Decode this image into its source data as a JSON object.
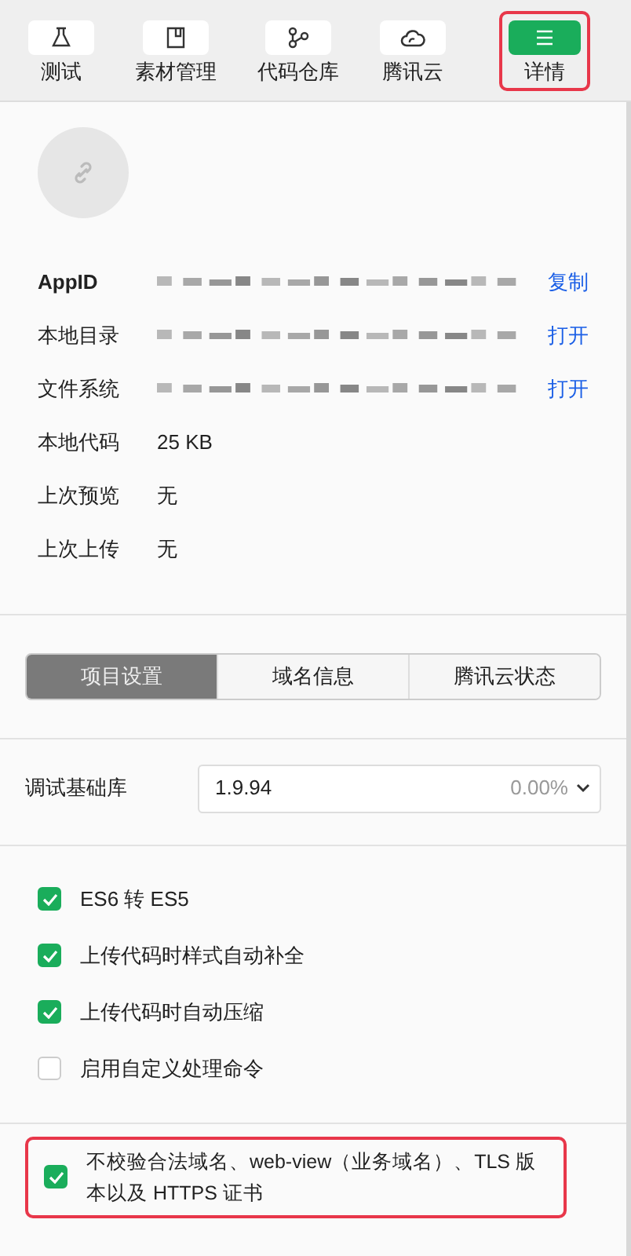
{
  "toolbar": [
    {
      "label": "测试",
      "selected": false,
      "highlighted": false
    },
    {
      "label": "素材管理",
      "selected": false,
      "highlighted": false
    },
    {
      "label": "代码仓库",
      "selected": false,
      "highlighted": false
    },
    {
      "label": "腾讯云",
      "selected": false,
      "highlighted": false
    },
    {
      "label": "详情",
      "selected": true,
      "highlighted": true
    }
  ],
  "info_rows": [
    {
      "label": "AppID",
      "kind": "blurred",
      "action": "复制",
      "bold": true
    },
    {
      "label": "本地目录",
      "kind": "blurred",
      "action": "打开",
      "bold": false
    },
    {
      "label": "文件系统",
      "kind": "blurred",
      "action": "打开",
      "bold": false
    },
    {
      "label": "本地代码",
      "kind": "text",
      "value": "25 KB",
      "bold": false
    },
    {
      "label": "上次预览",
      "kind": "text",
      "value": "无",
      "bold": false
    },
    {
      "label": "上次上传",
      "kind": "text",
      "value": "无",
      "bold": false
    }
  ],
  "tabs": [
    {
      "label": "项目设置",
      "selected": true
    },
    {
      "label": "域名信息",
      "selected": false
    },
    {
      "label": "腾讯云状态",
      "selected": false
    }
  ],
  "base_library": {
    "label": "调试基础库",
    "value": "1.9.94",
    "share": "0.00%"
  },
  "options": [
    {
      "label": "ES6 转 ES5",
      "checked": true
    },
    {
      "label": "上传代码时样式自动补全",
      "checked": true
    },
    {
      "label": "上传代码时自动压缩",
      "checked": true
    },
    {
      "label": "启用自定义处理命令",
      "checked": false
    }
  ],
  "extra_options": [
    {
      "label": "不校验合法域名、web-view（业务域名）、TLS 版本以及 HTTPS 证书",
      "checked": true,
      "highlighted": true
    }
  ]
}
